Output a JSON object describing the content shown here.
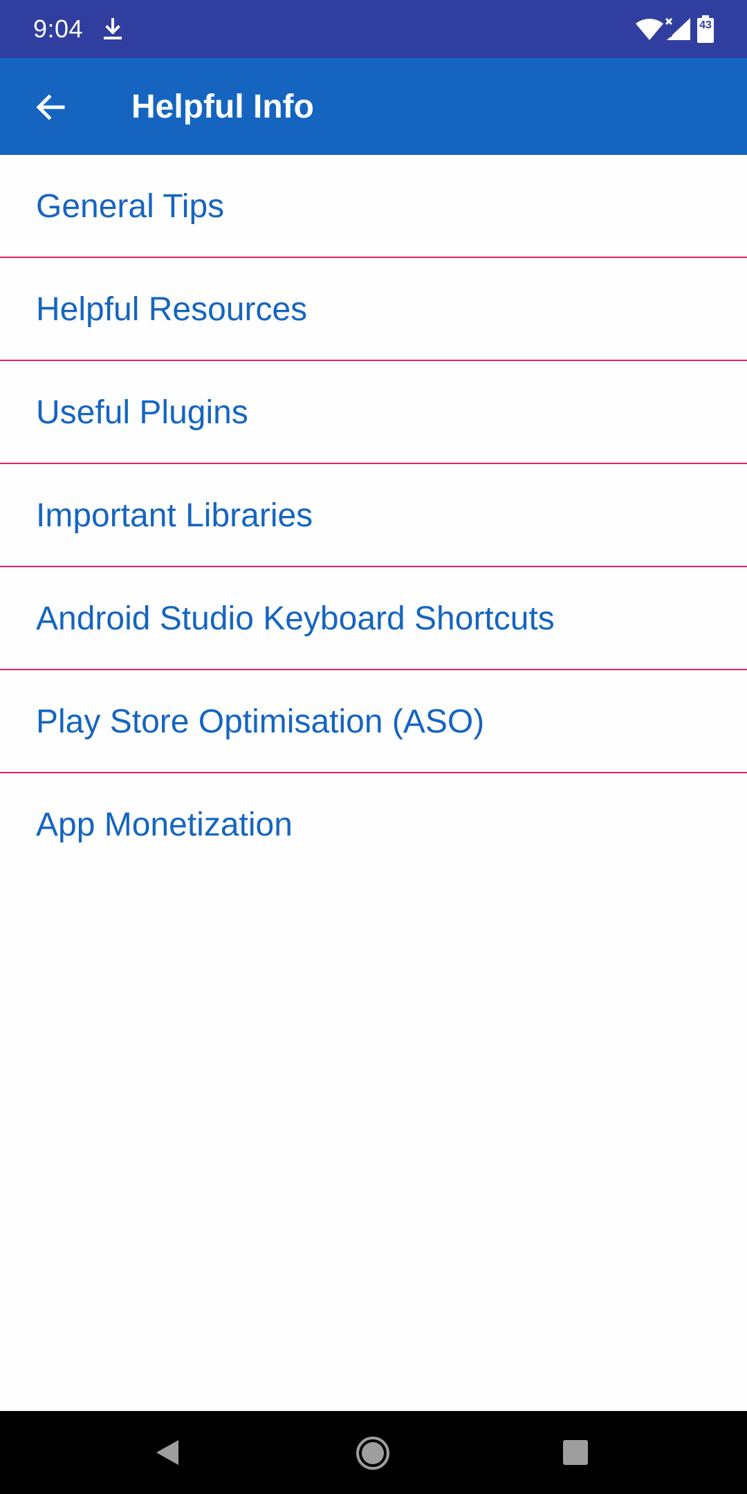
{
  "status_bar": {
    "time": "9:04",
    "battery_level": "43",
    "icons": [
      "download-icon",
      "wifi-icon",
      "cell-signal-icon",
      "battery-icon"
    ],
    "background_color": "#303f9f"
  },
  "app_bar": {
    "title": "Helpful Info",
    "back_icon": "arrow-back-icon",
    "background_color": "#1565c0"
  },
  "list": {
    "items": [
      {
        "label": "General Tips"
      },
      {
        "label": "Helpful Resources"
      },
      {
        "label": "Useful Plugins"
      },
      {
        "label": "Important Libraries"
      },
      {
        "label": "Android Studio Keyboard Shortcuts"
      },
      {
        "label": "Play Store Optimisation (ASO)"
      },
      {
        "label": "App Monetization"
      }
    ],
    "text_color": "#1565c0",
    "divider_color": "#e91e63"
  },
  "nav_bar": {
    "icons": [
      "nav-back-icon",
      "nav-home-icon",
      "nav-recents-icon"
    ]
  }
}
